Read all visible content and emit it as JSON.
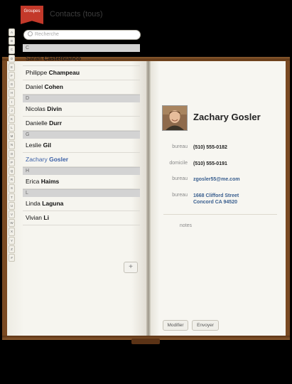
{
  "groups_label": "Groupes",
  "title": "Contacts (tous)",
  "search_placeholder": "Recherche",
  "index": [
    "A",
    "B",
    "C",
    "D",
    "E",
    "F",
    "G",
    "H",
    "I",
    "J",
    "K",
    "L",
    "M",
    "N",
    "O",
    "P",
    "Q",
    "R",
    "S",
    "T",
    "U",
    "V",
    "W",
    "X",
    "Y",
    "Z",
    "#"
  ],
  "sections": [
    {
      "letter": "C",
      "rows": [
        {
          "first": "Sarah",
          "last": "Castelblanco"
        },
        {
          "first": "Philippe",
          "last": "Champeau"
        },
        {
          "first": "Daniel",
          "last": "Cohen"
        }
      ]
    },
    {
      "letter": "D",
      "rows": [
        {
          "first": "Nicolas",
          "last": "Divin"
        },
        {
          "first": "Danielle",
          "last": "Durr"
        }
      ]
    },
    {
      "letter": "G",
      "rows": [
        {
          "first": "Leslie",
          "last": "Gil"
        },
        {
          "first": "Zachary",
          "last": "Gosler",
          "selected": true
        }
      ]
    },
    {
      "letter": "H",
      "rows": [
        {
          "first": "Erica",
          "last": "Haims"
        }
      ]
    },
    {
      "letter": "L",
      "rows": [
        {
          "first": "Linda",
          "last": "Laguna"
        },
        {
          "first": "Vivian",
          "last": "Li"
        }
      ]
    }
  ],
  "add_label": "+",
  "contact": {
    "name": "Zachary Gosler",
    "fields": [
      {
        "label": "bureau",
        "value": "(510) 555-0182"
      },
      {
        "label": "domicile",
        "value": "(510) 555-0191"
      },
      {
        "label": "bureau",
        "value": "zgosler55@me.com"
      },
      {
        "label": "bureau",
        "value": "1668 Clifford Street\nConcord CA 94520"
      }
    ],
    "notes_label": "notes"
  },
  "buttons": {
    "edit": "Modifier",
    "send": "Envoyer"
  },
  "colors": {
    "ribbon": "#c3392a",
    "selected": "#3a5fa6",
    "link": "#3a5f8f",
    "leather": "#7a4a22"
  }
}
